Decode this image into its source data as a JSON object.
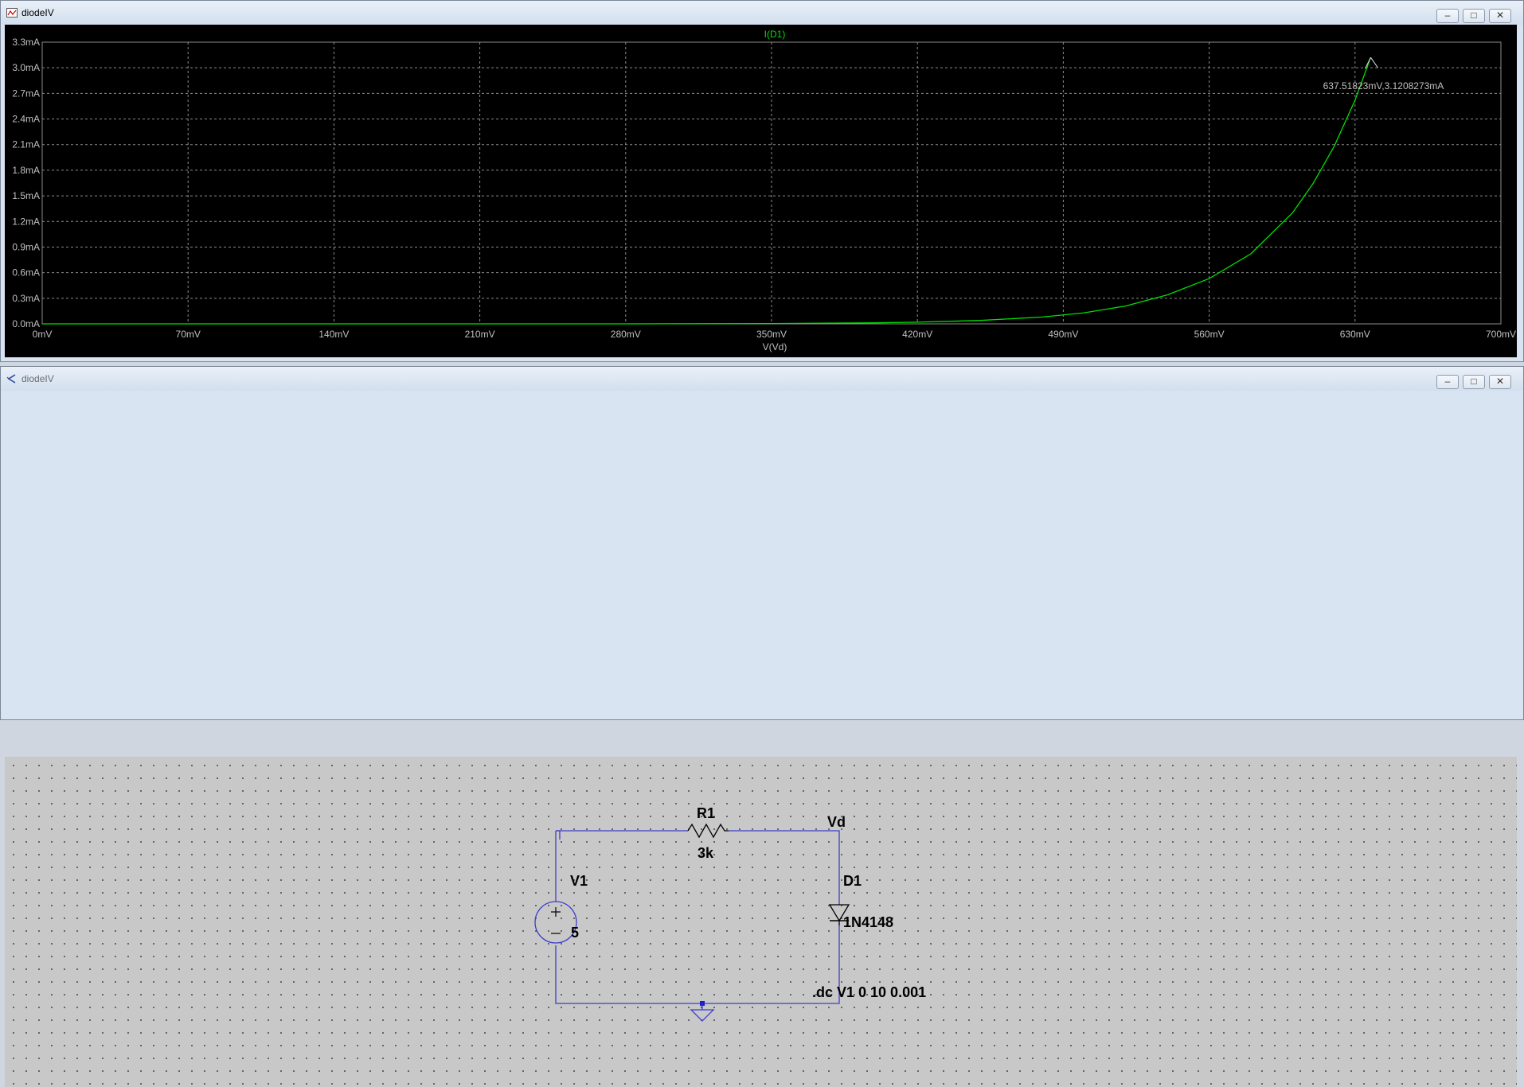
{
  "plot_window": {
    "title": "diodeIV",
    "buttons": {
      "minimize": "‒",
      "maximize": "□",
      "close": "✕"
    }
  },
  "schematic_window": {
    "title": "diodeIV",
    "buttons": {
      "minimize": "‒",
      "maximize": "□",
      "close": "✕"
    }
  },
  "colors": {
    "trace": "#00e000",
    "grid": "#8c8c8c",
    "axis_text": "#c0c0c0",
    "wire": "#3d3dc8",
    "schematic_bg": "#c8c8c8",
    "plot_bg": "#000000"
  },
  "chart_data": {
    "type": "line",
    "title": "I(D1)",
    "xlabel": "V(Vd)",
    "ylabel": "",
    "xlim": [
      0,
      700
    ],
    "ylim": [
      0,
      3.3
    ],
    "x_unit": "mV",
    "y_unit": "mA",
    "x_ticks": [
      "0mV",
      "70mV",
      "140mV",
      "210mV",
      "280mV",
      "350mV",
      "420mV",
      "490mV",
      "560mV",
      "630mV",
      "700mV"
    ],
    "y_ticks": [
      "0.0mA",
      "0.3mA",
      "0.6mA",
      "0.9mA",
      "1.2mA",
      "1.5mA",
      "1.8mA",
      "2.1mA",
      "2.4mA",
      "2.7mA",
      "3.0mA",
      "3.3mA"
    ],
    "grid": true,
    "series": [
      {
        "name": "I(D1)",
        "x": [
          0,
          70,
          140,
          210,
          280,
          350,
          400,
          420,
          450,
          480,
          500,
          520,
          540,
          560,
          580,
          600,
          610,
          620,
          630,
          637.5
        ],
        "y": [
          0,
          0,
          0,
          0,
          0,
          0.004,
          0.012,
          0.02,
          0.04,
          0.08,
          0.13,
          0.21,
          0.34,
          0.53,
          0.82,
          1.3,
          1.65,
          2.08,
          2.62,
          3.12
        ]
      }
    ],
    "cursor": {
      "x": 637.51823,
      "y": 3.1208273,
      "label": "637.51823mV,3.1208273mA"
    }
  },
  "schematic": {
    "components": {
      "r1": {
        "name": "R1",
        "value": "3k"
      },
      "v1": {
        "name": "V1",
        "value": "5"
      },
      "d1": {
        "name": "D1",
        "value": "1N4148"
      }
    },
    "net_label": "Vd",
    "directive": ".dc V1 0 10 0.001"
  }
}
